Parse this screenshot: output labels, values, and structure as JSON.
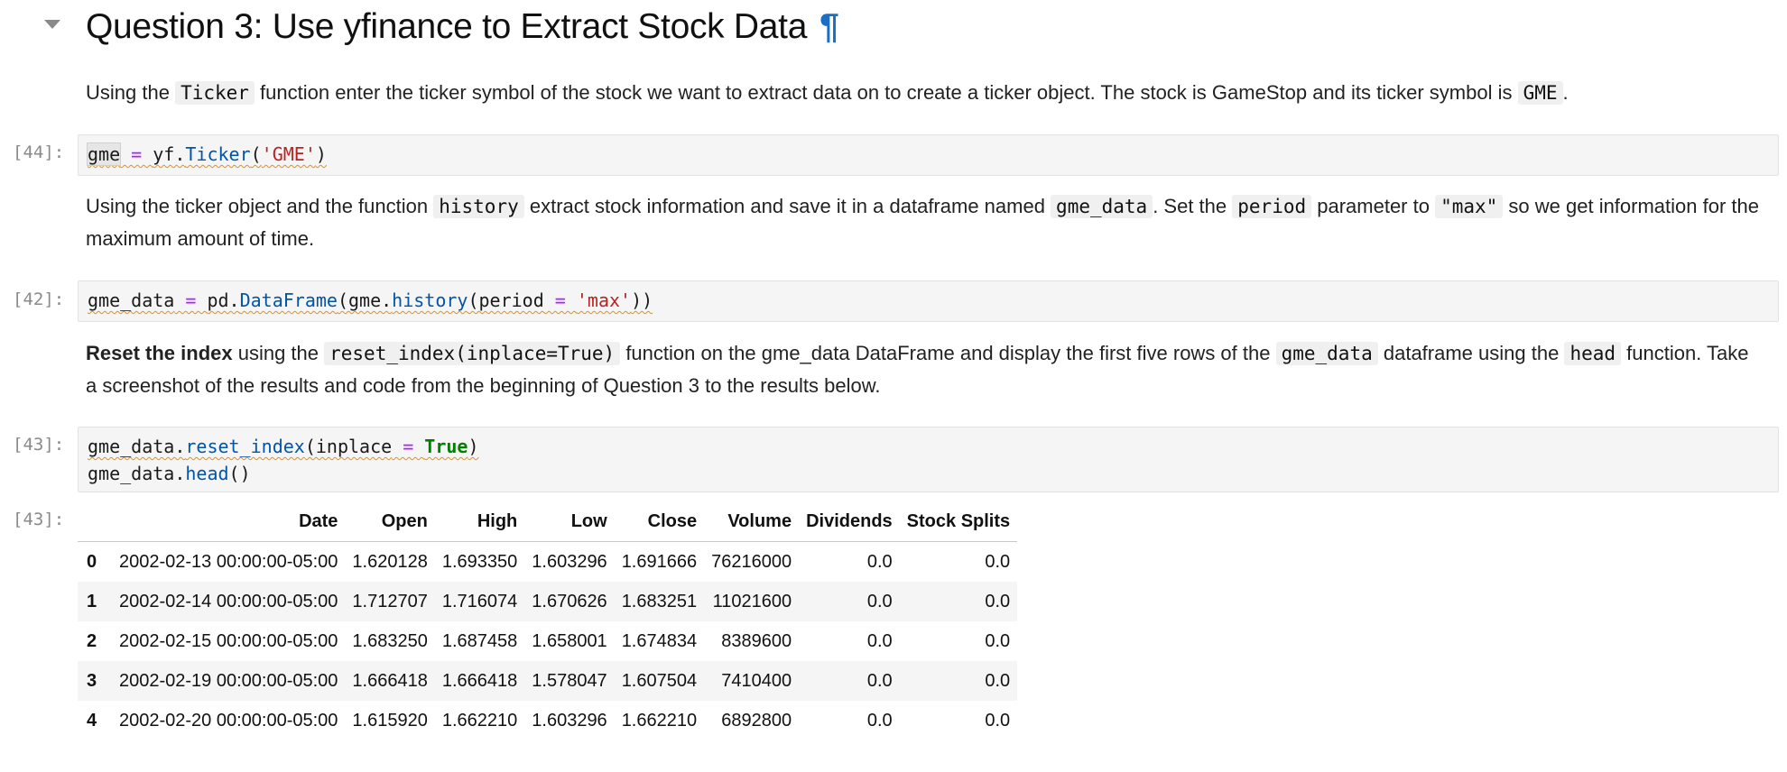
{
  "heading": {
    "title": "Question 3: Use yfinance to Extract Stock Data",
    "anchor": "¶"
  },
  "para1": {
    "t1": "Using the ",
    "c1": "Ticker",
    "t2": " function enter the ticker symbol of the stock we want to extract data on to create a ticker object. The stock is GameStop and its ticker symbol is ",
    "c2": "GME",
    "t3": "."
  },
  "cell44": {
    "prompt": "[44]:",
    "code": {
      "var": "gme",
      "eq": " = ",
      "obj": "yf.",
      "fn": "Ticker",
      "open": "(",
      "str": "'GME'",
      "close": ")"
    }
  },
  "para2": {
    "t1": "Using the ticker object and the function ",
    "c1": "history",
    "t2": " extract stock information and save it in a dataframe named ",
    "c2": "gme_data",
    "t3": ". Set the ",
    "c3": "period",
    "t4": " parameter to ",
    "c4": "\"max\"",
    "t5": " so we get information for the maximum amount of time."
  },
  "cell42": {
    "prompt": "[42]:",
    "code": {
      "var": "gme_data",
      "eq": " = ",
      "obj": "pd.",
      "fn": "DataFrame",
      "open": "(gme.",
      "fn2": "history",
      "arg": "(period",
      "eq2": " = ",
      "str": "'max'",
      "close": "))"
    }
  },
  "para3": {
    "bold": "Reset the index",
    "t1": " using the ",
    "c1": "reset_index(inplace=True)",
    "t2": " function on the gme_data DataFrame and display the first five rows of the ",
    "c2": "gme_data",
    "t3": " dataframe using the ",
    "c3": "head",
    "t4": " function. Take a screenshot of the results and code from the beginning of Question 3 to the results below."
  },
  "cell43": {
    "prompt": "[43]:",
    "line1": {
      "obj": "gme_data.",
      "fn": "reset_index",
      "arg": "(inplace",
      "eq": " = ",
      "kw": "True",
      "close": ")"
    },
    "line2": {
      "obj": "gme_data.",
      "fn": "head",
      "close": "()"
    }
  },
  "output43": {
    "prompt": "[43]:",
    "columns": [
      "",
      "Date",
      "Open",
      "High",
      "Low",
      "Close",
      "Volume",
      "Dividends",
      "Stock Splits"
    ],
    "rows": [
      [
        "0",
        "2002-02-13 00:00:00-05:00",
        "1.620128",
        "1.693350",
        "1.603296",
        "1.691666",
        "76216000",
        "0.0",
        "0.0"
      ],
      [
        "1",
        "2002-02-14 00:00:00-05:00",
        "1.712707",
        "1.716074",
        "1.670626",
        "1.683251",
        "11021600",
        "0.0",
        "0.0"
      ],
      [
        "2",
        "2002-02-15 00:00:00-05:00",
        "1.683250",
        "1.687458",
        "1.658001",
        "1.674834",
        "8389600",
        "0.0",
        "0.0"
      ],
      [
        "3",
        "2002-02-19 00:00:00-05:00",
        "1.666418",
        "1.666418",
        "1.578047",
        "1.607504",
        "7410400",
        "0.0",
        "0.0"
      ],
      [
        "4",
        "2002-02-20 00:00:00-05:00",
        "1.615920",
        "1.662210",
        "1.603296",
        "1.662210",
        "6892800",
        "0.0",
        "0.0"
      ]
    ]
  },
  "colors": {
    "accent": "#1a6fc4",
    "keyword": "#008000",
    "operator": "#aa22ff",
    "function": "#0055aa",
    "string": "#ba2121"
  }
}
